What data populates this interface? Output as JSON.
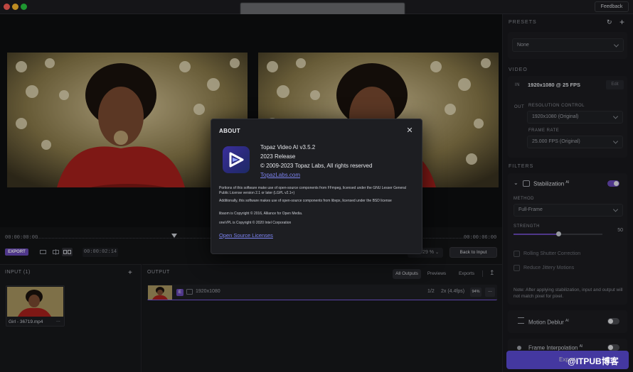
{
  "titlebar": {
    "feedback_label": "Feedback"
  },
  "timeline": {
    "start_time": "00:00:00:00",
    "end_time": "00:00:06:00",
    "export_label": "EXPORT",
    "current_time": "00:00:02:14",
    "zoom_value": "29 %",
    "back_to_input_label": "Back to Input"
  },
  "input_panel": {
    "title": "INPUT (1)",
    "add_icon": "+",
    "file_name": "Girl - 36719.mp4",
    "more": "..."
  },
  "output_panel": {
    "title": "OUTPUT",
    "tabs": [
      "All Outputs",
      "Previews",
      "Exports"
    ],
    "row": {
      "badge": "E",
      "resolution": "1920x1080",
      "progress": "1/2",
      "speed": "2x (4.4fps)",
      "percent": "94%",
      "more": "..."
    }
  },
  "sidebar": {
    "presets": {
      "title": "PRESETS",
      "selected": "None"
    },
    "video": {
      "title": "VIDEO",
      "in_label": "IN",
      "in_value": "1920x1080 @ 25 FPS",
      "edit_label": "Edit",
      "out_label": "OUT",
      "resolution_label": "RESOLUTION CONTROL",
      "resolution_value": "1920x1080 (Original)",
      "frame_rate_label": "FRAME RATE",
      "frame_rate_value": "25.000 FPS (Original)"
    },
    "filters": {
      "title": "FILTERS",
      "stabilization": {
        "label": "Stabilization",
        "ai_tag": "AI",
        "enabled": true,
        "method_label": "METHOD",
        "method_value": "Full-Frame",
        "strength_label": "STRENGTH",
        "strength_value": "50",
        "strength_fraction": 0.5,
        "rolling_shutter_label": "Rolling Shutter Correction",
        "jittery_label": "Reduce Jittery Motions",
        "note": "Note: After applying stabilization, input and output will not match pixel for pixel."
      },
      "motion_deblur": {
        "label": "Motion Deblur",
        "ai_tag": "AI",
        "enabled": false
      },
      "frame_interpolation": {
        "label": "Frame Interpolation",
        "ai_tag": "AI",
        "enabled": false
      }
    },
    "export_button": "Export"
  },
  "about": {
    "title": "ABOUT",
    "app_name": "Topaz Video AI  v3.5.2",
    "release": "2023 Release",
    "copyright": "© 2009-2023 Topaz Labs, All rights reserved",
    "website": "TopazLabs.com",
    "license_1": "Portions of this software make use of open-source components from FFmpeg, licensed under the GNU Lesser General Public License version 2.1 or later (LGPL v2.1+)",
    "license_2": "Additionally, this software makes use of open-source components from libvpx, licensed under the BSD license",
    "license_3": "libaom is Copyright © 2016, Alliance for Open Media.",
    "license_4": "oneVPL is Copyright © 2020 Intel Corporation",
    "open_source_link": "Open Source Licenses"
  },
  "watermark": "@ITPUB博客",
  "colors": {
    "accent": "#6a4ab8",
    "link": "#7c83f0",
    "background": "#111214"
  }
}
